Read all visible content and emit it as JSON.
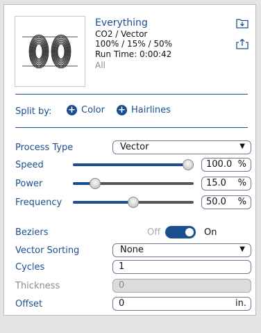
{
  "job": {
    "title": "Everything",
    "line1": "CO2 / Vector",
    "line2": "100% / 15% / 50%",
    "run_time": "Run Time: 0:00:42",
    "scope": "All"
  },
  "split": {
    "label": "Split by:",
    "color_label": "Color",
    "hairlines_label": "Hairlines"
  },
  "process_type": {
    "label": "Process Type",
    "value": "Vector"
  },
  "speed": {
    "label": "Speed",
    "value": "100.0",
    "unit": "%",
    "fraction": 1.0
  },
  "power": {
    "label": "Power",
    "value": "15.0",
    "unit": "%",
    "fraction": 0.15
  },
  "frequency": {
    "label": "Frequency",
    "value": "50.0",
    "unit": "%",
    "fraction": 0.5
  },
  "beziers": {
    "label": "Beziers",
    "off_label": "Off",
    "on_label": "On",
    "state": "on"
  },
  "vector_sorting": {
    "label": "Vector Sorting",
    "value": "None"
  },
  "cycles": {
    "label": "Cycles",
    "value": "1"
  },
  "thickness": {
    "label": "Thickness",
    "value": "0"
  },
  "offset": {
    "label": "Offset",
    "value": "0",
    "unit": "in."
  },
  "colors": {
    "accent": "#1a4f8f",
    "disabled": "#8a8a8a"
  },
  "icons": {
    "import": "folder-import-icon",
    "export": "export-icon",
    "add": "plus-circle-icon",
    "dropdown": "triangle-down-icon"
  }
}
